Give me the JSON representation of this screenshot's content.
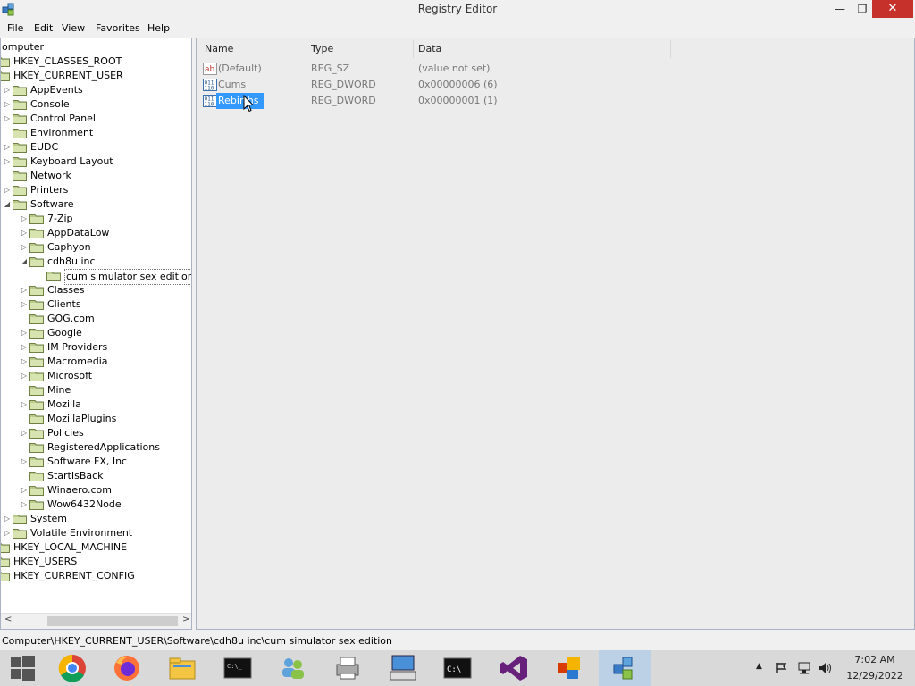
{
  "window": {
    "title": "Registry Editor",
    "min_icon": "minimize-icon",
    "max_icon": "restore-icon",
    "close_icon": "close-icon",
    "min_glyph": "—",
    "max_glyph": "❐",
    "close_glyph": "✕"
  },
  "menu": [
    "File",
    "Edit",
    "View",
    "Favorites",
    "Help"
  ],
  "tree": {
    "root": "omputer",
    "items": [
      {
        "label": "HKEY_CLASSES_ROOT",
        "level": 0,
        "arrow": ""
      },
      {
        "label": "HKEY_CURRENT_USER",
        "level": 0,
        "arrow": ""
      },
      {
        "label": "AppEvents",
        "level": 1,
        "arrow": "▷"
      },
      {
        "label": "Console",
        "level": 1,
        "arrow": "▷"
      },
      {
        "label": "Control Panel",
        "level": 1,
        "arrow": "▷"
      },
      {
        "label": "Environment",
        "level": 1,
        "arrow": ""
      },
      {
        "label": "EUDC",
        "level": 1,
        "arrow": "▷"
      },
      {
        "label": "Keyboard Layout",
        "level": 1,
        "arrow": "▷"
      },
      {
        "label": "Network",
        "level": 1,
        "arrow": ""
      },
      {
        "label": "Printers",
        "level": 1,
        "arrow": "▷"
      },
      {
        "label": "Software",
        "level": 1,
        "arrow": "◢"
      },
      {
        "label": "7-Zip",
        "level": 2,
        "arrow": "▷"
      },
      {
        "label": "AppDataLow",
        "level": 2,
        "arrow": "▷"
      },
      {
        "label": "Caphyon",
        "level": 2,
        "arrow": "▷"
      },
      {
        "label": "cdh8u inc",
        "level": 2,
        "arrow": "◢"
      },
      {
        "label": "cum simulator sex edition",
        "level": 3,
        "arrow": "",
        "selected": true
      },
      {
        "label": "Classes",
        "level": 2,
        "arrow": "▷"
      },
      {
        "label": "Clients",
        "level": 2,
        "arrow": "▷"
      },
      {
        "label": "GOG.com",
        "level": 2,
        "arrow": ""
      },
      {
        "label": "Google",
        "level": 2,
        "arrow": "▷"
      },
      {
        "label": "IM Providers",
        "level": 2,
        "arrow": "▷"
      },
      {
        "label": "Macromedia",
        "level": 2,
        "arrow": "▷"
      },
      {
        "label": "Microsoft",
        "level": 2,
        "arrow": "▷"
      },
      {
        "label": "Mine",
        "level": 2,
        "arrow": ""
      },
      {
        "label": "Mozilla",
        "level": 2,
        "arrow": "▷"
      },
      {
        "label": "MozillaPlugins",
        "level": 2,
        "arrow": ""
      },
      {
        "label": "Policies",
        "level": 2,
        "arrow": "▷"
      },
      {
        "label": "RegisteredApplications",
        "level": 2,
        "arrow": ""
      },
      {
        "label": "Software FX, Inc",
        "level": 2,
        "arrow": "▷"
      },
      {
        "label": "StartIsBack",
        "level": 2,
        "arrow": ""
      },
      {
        "label": "Winaero.com",
        "level": 2,
        "arrow": "▷"
      },
      {
        "label": "Wow6432Node",
        "level": 2,
        "arrow": "▷"
      },
      {
        "label": "System",
        "level": 1,
        "arrow": "▷"
      },
      {
        "label": "Volatile Environment",
        "level": 1,
        "arrow": "▷"
      },
      {
        "label": "HKEY_LOCAL_MACHINE",
        "level": 0,
        "arrow": ""
      },
      {
        "label": "HKEY_USERS",
        "level": 0,
        "arrow": ""
      },
      {
        "label": "HKEY_CURRENT_CONFIG",
        "level": 0,
        "arrow": ""
      }
    ]
  },
  "list": {
    "headers": [
      "Name",
      "Type",
      "Data"
    ],
    "rows": [
      {
        "icon": "string-value-icon",
        "name": "(Default)",
        "type": "REG_SZ",
        "data": "(value not set)"
      },
      {
        "icon": "binary-value-icon",
        "name": "Cums",
        "type": "REG_DWORD",
        "data": "0x00000006 (6)"
      },
      {
        "icon": "binary-value-icon",
        "name": "Rebirths",
        "type": "REG_DWORD",
        "data": "0x00000001 (1)",
        "selected": true
      }
    ]
  },
  "status": "Computer\\HKEY_CURRENT_USER\\Software\\cdh8u inc\\cum simulator sex edition",
  "taskbar": {
    "items": [
      {
        "icon": "windows-start-icon"
      },
      {
        "icon": "chrome-icon"
      },
      {
        "icon": "firefox-icon"
      },
      {
        "icon": "file-explorer-icon"
      },
      {
        "icon": "console-icon"
      },
      {
        "icon": "network-users-icon"
      },
      {
        "icon": "printer-fax-icon"
      },
      {
        "icon": "keyboard-monitor-icon"
      },
      {
        "icon": "command-prompt-icon"
      },
      {
        "icon": "visual-studio-icon"
      },
      {
        "icon": "office-shapes-icon"
      },
      {
        "icon": "registry-editor-icon",
        "active": true
      }
    ],
    "time": "7:02 AM",
    "date": "12/29/2022"
  }
}
